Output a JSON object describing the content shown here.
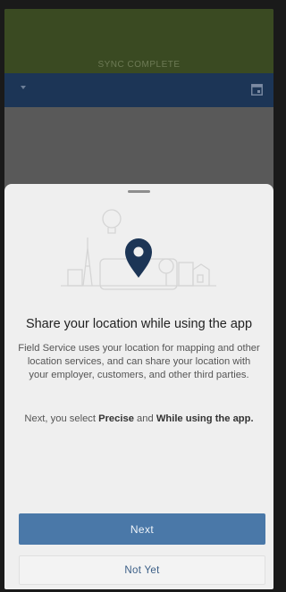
{
  "status_bar": {
    "text": "SYNC COMPLETE",
    "color": "#3a4a22"
  },
  "nav": {
    "background": "#1c3556",
    "dropdown_icon": "caret-down-icon",
    "calendar_icon": "calendar-icon"
  },
  "dialog": {
    "title": "Share your location while using the app",
    "body": "Field Service uses your location for mapping and other location services, and can share your location with your employer, customers, and other third parties.",
    "next_prefix": "Next, you select ",
    "next_precise": "Precise",
    "next_and": " and ",
    "next_while": "While using the app.",
    "illustration_icon": "location-pin-icon",
    "pin_color": "#1c3556"
  },
  "buttons": {
    "next_label": "Next",
    "not_yet_label": "Not Yet",
    "accent": "#4a78a8"
  }
}
